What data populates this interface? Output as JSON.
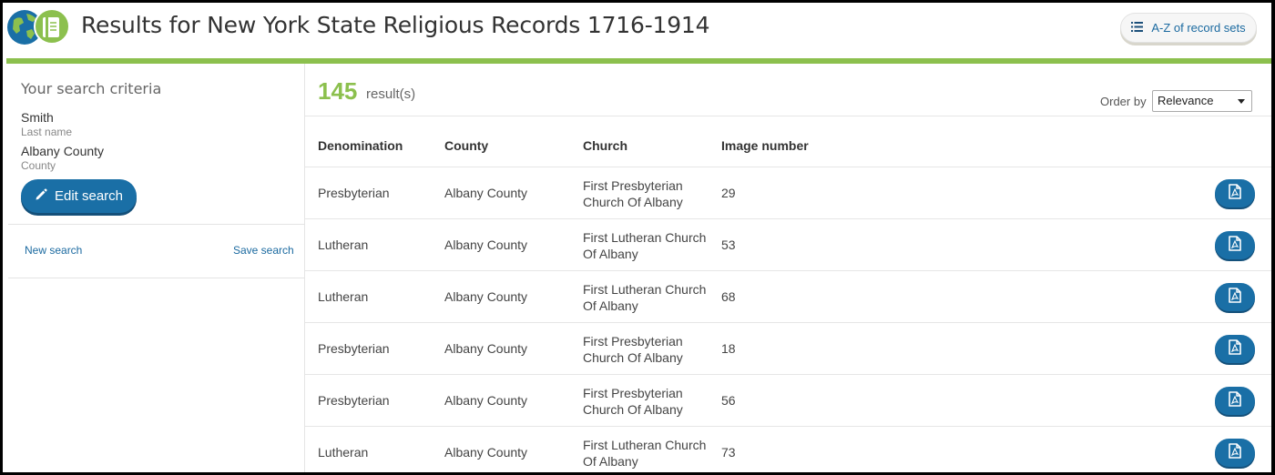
{
  "header": {
    "title": "Results for New York State Religious Records 1716-1914",
    "az_button": "A-Z of record sets"
  },
  "sidebar": {
    "heading": "Your search criteria",
    "criteria": [
      {
        "value": "Smith",
        "label": "Last name"
      },
      {
        "value": "Albany County",
        "label": "County"
      }
    ],
    "edit_button": "Edit search",
    "new_search": "New search",
    "save_search": "Save search"
  },
  "results": {
    "count": "145",
    "count_label": "result(s)",
    "order_label": "Order by",
    "order_selected": "Relevance",
    "columns": [
      "Denomination",
      "County",
      "Church",
      "Image number"
    ],
    "rows": [
      {
        "denomination": "Presbyterian",
        "county": "Albany County",
        "church": "First Presbyterian Church Of Albany",
        "image": "29"
      },
      {
        "denomination": "Lutheran",
        "county": "Albany County",
        "church": "First Lutheran Church Of Albany",
        "image": "53"
      },
      {
        "denomination": "Lutheran",
        "county": "Albany County",
        "church": "First Lutheran Church Of Albany",
        "image": "68"
      },
      {
        "denomination": "Presbyterian",
        "county": "Albany County",
        "church": "First Presbyterian Church Of Albany",
        "image": "18"
      },
      {
        "denomination": "Presbyterian",
        "county": "Albany County",
        "church": "First Presbyterian Church Of Albany",
        "image": "56"
      },
      {
        "denomination": "Lutheran",
        "county": "Albany County",
        "church": "First Lutheran Church Of Albany",
        "image": "73"
      }
    ]
  },
  "icons": {
    "logo": "globe-book-logo-icon",
    "az": "list-icon",
    "edit": "pencil-icon",
    "row_action": "pdf-icon"
  },
  "colors": {
    "accent_green": "#8cc04e",
    "button_blue": "#1a6fa6",
    "link_blue": "#1b6aa0"
  }
}
